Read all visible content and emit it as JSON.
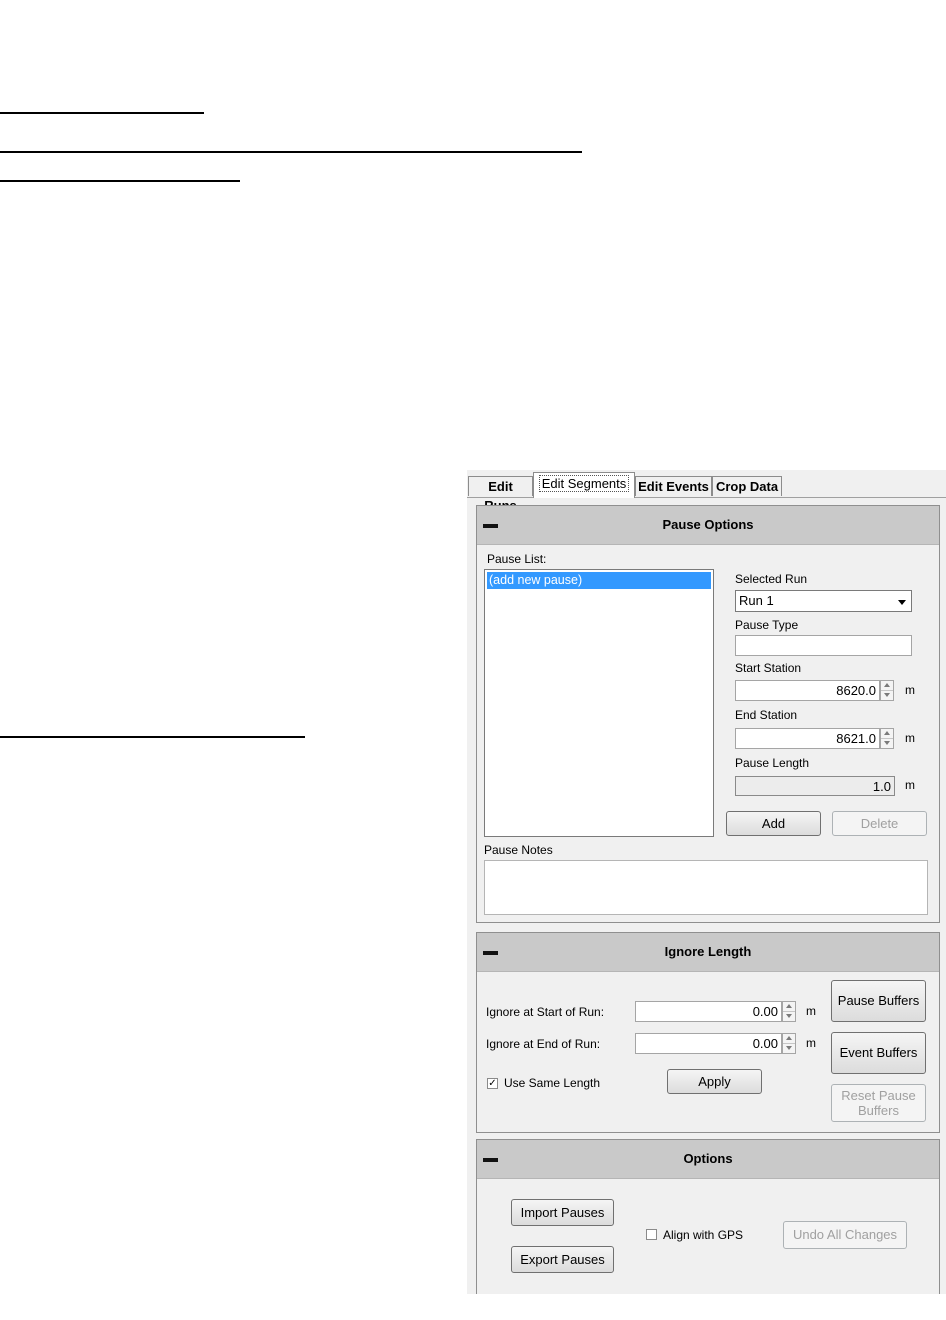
{
  "tabs": [
    {
      "label": "Edit Runs"
    },
    {
      "label": "Edit Segments"
    },
    {
      "label": "Edit Events"
    },
    {
      "label": "Crop Data"
    }
  ],
  "pause_options": {
    "title": "Pause Options",
    "pause_list_label": "Pause List:",
    "pause_list_items": [
      "(add new pause)"
    ],
    "selected_run_label": "Selected Run",
    "selected_run_value": "Run 1",
    "pause_type_label": "Pause Type",
    "pause_type_value": "",
    "start_station_label": "Start Station",
    "start_station_value": "8620.0",
    "end_station_label": "End Station",
    "end_station_value": "8621.0",
    "pause_length_label": "Pause Length",
    "pause_length_value": "1.0",
    "unit": "m",
    "add_button": "Add",
    "delete_button": "Delete",
    "pause_notes_label": "Pause Notes",
    "pause_notes_value": ""
  },
  "ignore_length": {
    "title": "Ignore Length",
    "start_label": "Ignore at Start of Run:",
    "start_value": "0.00",
    "end_label": "Ignore at End of Run:",
    "end_value": "0.00",
    "unit": "m",
    "use_same_length_label": "Use Same Length",
    "use_same_length_checked": true,
    "apply_button": "Apply",
    "pause_buffers_button": "Pause Buffers",
    "event_buffers_button": "Event Buffers",
    "reset_pause_buffers_button_line1": "Reset Pause",
    "reset_pause_buffers_button_line2": "Buffers"
  },
  "options": {
    "title": "Options",
    "import_pauses_button": "Import Pauses",
    "export_pauses_button": "Export Pauses",
    "align_with_gps_label": "Align with GPS",
    "align_with_gps_checked": false,
    "undo_all_changes_button": "Undo All Changes"
  }
}
